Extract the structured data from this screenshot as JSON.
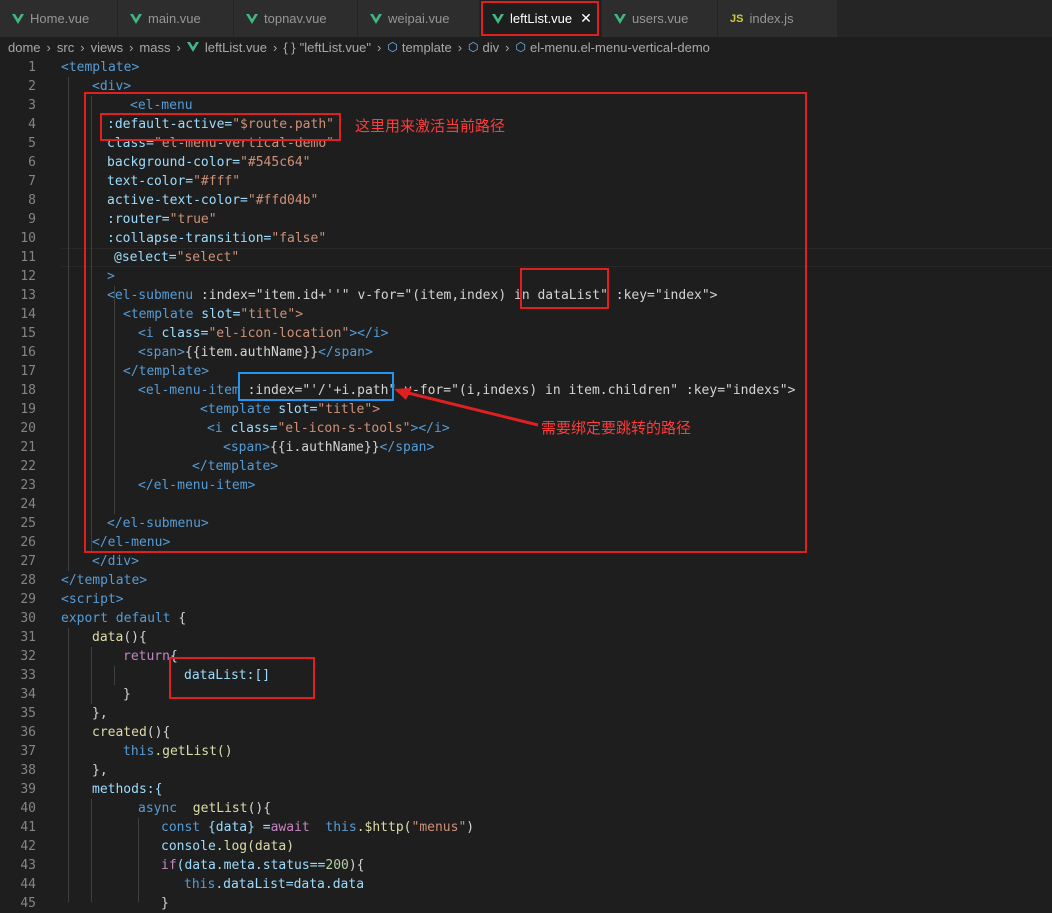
{
  "tabs": [
    {
      "label": "Home.vue",
      "icon": "vue-icon"
    },
    {
      "label": "main.vue",
      "icon": "vue-icon"
    },
    {
      "label": "topnav.vue",
      "icon": "vue-icon"
    },
    {
      "label": "weipai.vue",
      "icon": "vue-icon"
    },
    {
      "label": "leftList.vue",
      "icon": "vue-icon",
      "active": true,
      "close": "✕"
    },
    {
      "label": "users.vue",
      "icon": "vue-icon"
    },
    {
      "label": "index.js",
      "icon": "js-icon",
      "icon_text": "JS"
    }
  ],
  "breadcrumb": {
    "parts": [
      "dome",
      "src",
      "views",
      "mass",
      "leftList.vue",
      "\"leftList.vue\"",
      "template",
      "div",
      "el-menu.el-menu-vertical-demo"
    ],
    "braces": "{ }"
  },
  "annotations": {
    "note1": "这里用来激活当前路径",
    "note2": "需要绑定要跳转的路径"
  },
  "colors": {
    "highlight_red": "#e02020",
    "highlight_blue": "#2196f3",
    "tag": "#569cd6",
    "string": "#ce9178",
    "attr": "#9cdcfe"
  },
  "code": {
    "l1": "<template>",
    "l2": "<div>",
    "l3": "<el-menu",
    "l4a": ":default-active=",
    "l4b": "\"$route.path\"",
    "l5a": "class=",
    "l5b": "\"el-menu-vertical-demo\"",
    "l6a": "background-color=",
    "l6b": "\"#545c64\"",
    "l7a": "text-color=",
    "l7b": "\"#fff\"",
    "l8a": "active-text-color=",
    "l8b": "\"#ffd04b\"",
    "l9a": ":router=",
    "l9b": "\"true\"",
    "l10a": ":collapse-transition=",
    "l10b": "\"false\"",
    "l11a": "@select=",
    "l11b": "\"select\"",
    "l12": ">",
    "l13a": "<el-submenu",
    "l13b": " :index=\"item.id+''\" v-for=\"(item,index) in ",
    "l13c": "dataList\"",
    "l13d": " :key=\"index\">",
    "l14a": "<template",
    "l14b": " slot=",
    "l14c": "\"title\">",
    "l15a": "<i",
    "l15b": " class=",
    "l15c": "\"el-icon-location\"",
    "l15d": "></i>",
    "l16a": "<span>",
    "l16b": "{{item.authName}}",
    "l16c": "</span>",
    "l17": "</template>",
    "l18a": "<el-menu-item",
    "l18b": " :index=\"'/'+i.path\"",
    "l18c": " v-for=\"(i,indexs) in item.children\" :key=\"indexs\">",
    "l19a": "<template",
    "l19b": " slot=",
    "l19c": "\"title\">",
    "l20a": "<i",
    "l20b": " class=",
    "l20c": "\"el-icon-s-tools\"",
    "l20d": "></i>",
    "l21a": "<span>",
    "l21b": "{{i.authName}}",
    "l21c": "</span>",
    "l22": "</template>",
    "l23": "</el-menu-item>",
    "l25": "</el-submenu>",
    "l26": "</el-menu>",
    "l27": "</div>",
    "l28": "</template>",
    "l29": "<script>",
    "l30a": "export default",
    "l30b": " {",
    "l31a": "data",
    "l31b": "(){",
    "l32a": "return",
    "l32b": "{",
    "l33": "dataList:[]",
    "l34": "}",
    "l35": "},",
    "l36a": "created",
    "l36b": "(){",
    "l37a": "this",
    "l37b": ".getList()",
    "l38": "},",
    "l39": "methods:{",
    "l40a": "async",
    "l40b": "  getList",
    "l40c": "(){",
    "l41a": "const",
    "l41b": " {data} =",
    "l41c": "await",
    "l41d": "  this",
    "l41e": ".$http(",
    "l41f": "\"menus\"",
    "l41g": ")",
    "l42a": "console",
    "l42b": ".log(data)",
    "l43a": "if",
    "l43b": "(data.meta.status==",
    "l43c": "200",
    "l43d": "){",
    "l44a": "this",
    "l44b": ".dataList=data.data",
    "l45": "}"
  },
  "line_numbers": [
    "1",
    "2",
    "3",
    "4",
    "5",
    "6",
    "7",
    "8",
    "9",
    "10",
    "11",
    "12",
    "13",
    "14",
    "15",
    "16",
    "17",
    "18",
    "19",
    "20",
    "21",
    "22",
    "23",
    "24",
    "25",
    "26",
    "27",
    "28",
    "29",
    "30",
    "31",
    "32",
    "33",
    "34",
    "35",
    "36",
    "37",
    "38",
    "39",
    "40",
    "41",
    "42",
    "43",
    "44",
    "45"
  ]
}
